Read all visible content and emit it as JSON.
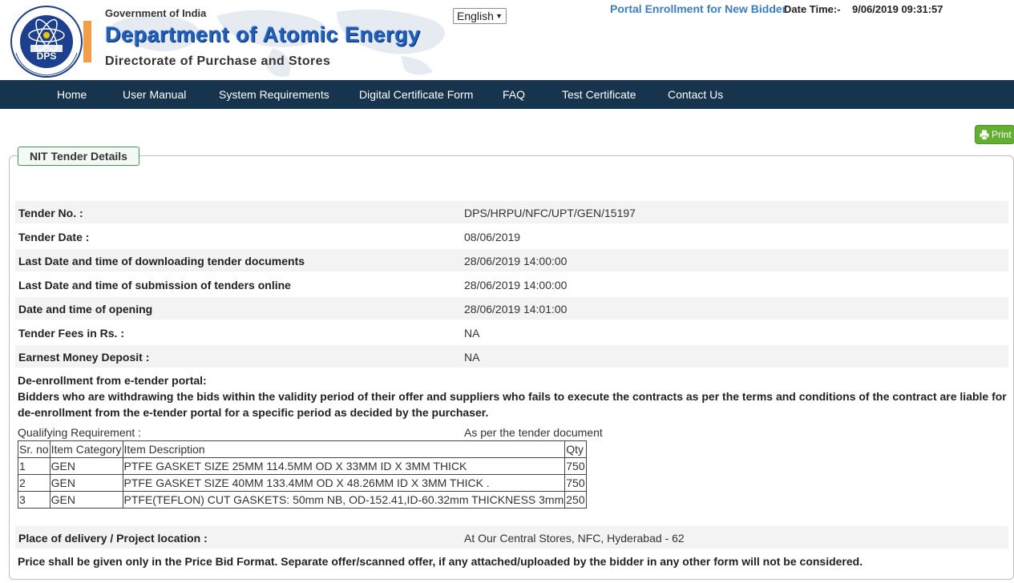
{
  "header": {
    "gov_text": "Government of India",
    "dept_text": "Department of Atomic Energy",
    "dir_text": "Directorate of Purchase and Stores",
    "logo_text": "DPS",
    "language_select": "English",
    "enrollment_link": "Portal Enrollment for New Bidder",
    "datetime_label": "Date Time:-",
    "datetime_value": "9/06/2019 09:31:57"
  },
  "nav": {
    "items": [
      "Home",
      "User Manual",
      "System Requirements",
      "Digital Certificate Form",
      "FAQ",
      "Test Certificate",
      "Contact Us"
    ]
  },
  "print_label": "Print",
  "section_title": "NIT Tender Details",
  "details": [
    {
      "label": "Tender No. :",
      "value": "DPS/HRPU/NFC/UPT/GEN/15197"
    },
    {
      "label": "Tender Date :",
      "value": "08/06/2019"
    },
    {
      "label": "Last Date and time of downloading tender documents",
      "value": "28/06/2019 14:00:00"
    },
    {
      "label": "Last Date and time of submission of tenders online",
      "value": "28/06/2019 14:00:00"
    },
    {
      "label": "Date and time of opening",
      "value": "28/06/2019 14:01:00"
    },
    {
      "label": "Tender Fees in Rs. :",
      "value": "NA"
    },
    {
      "label": "Earnest Money Deposit :",
      "value": "NA"
    }
  ],
  "deenroll": {
    "heading": "De-enrollment from e-tender portal:",
    "line1": "Bidders who are withdrawing the bids within the validity period of their offer and suppliers who fails to execute the contracts as per the terms and conditions of the contract are liable for",
    "line2": "de-enrollment from the e-tender portal for a specific period as decided by the purchaser."
  },
  "qualifying": {
    "label": "Qualifying Requirement :",
    "value": "As per the tender document"
  },
  "items_table": {
    "headers": [
      "Sr. no",
      "Item Category",
      "Item Description",
      "Qty"
    ],
    "rows": [
      [
        "1",
        "GEN",
        "PTFE GASKET SIZE 25MM 114.5MM OD X 33MM ID X 3MM THICK",
        "750"
      ],
      [
        "2",
        "GEN",
        "PTFE GASKET SIZE 40MM 133.4MM OD X 48.26MM ID X 3MM THICK .",
        "750"
      ],
      [
        "3",
        "GEN",
        "PTFE(TEFLON) CUT GASKETS: 50mm NB, OD-152.41,ID-60.32mm THICKNESS 3mm",
        "250"
      ]
    ]
  },
  "delivery": {
    "label": "Place of delivery / Project location :",
    "value": "At Our Central Stores, NFC, Hyderabad - 62"
  },
  "price_note": "Price shall be given only in the Price Bid Format. Separate offer/scanned offer, if any attached/uploaded by the bidder in any other form will not be considered."
}
